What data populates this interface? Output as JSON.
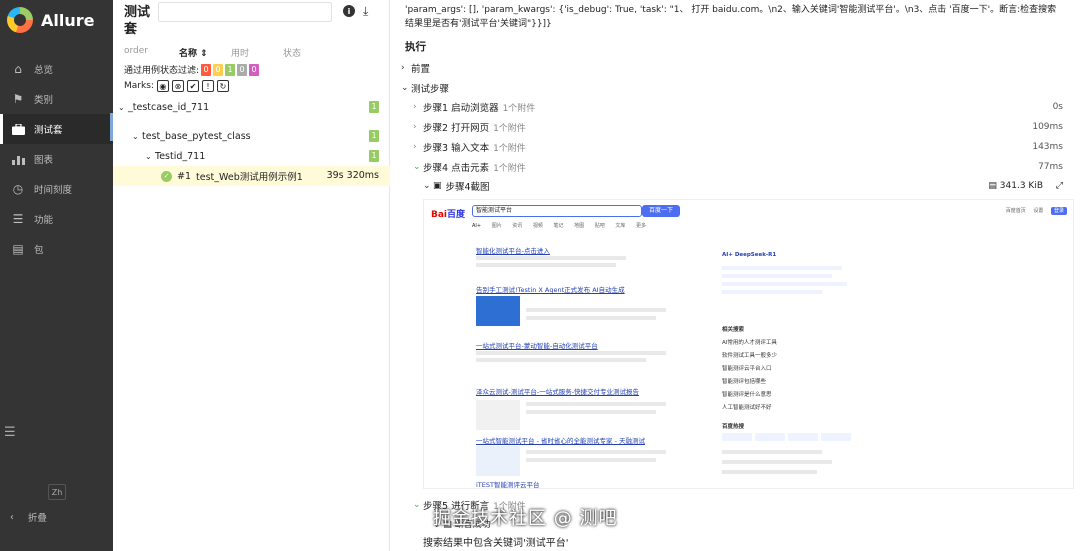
{
  "sidebar": {
    "brand": "Allure",
    "items": [
      {
        "label": "总览",
        "icon": "home-icon"
      },
      {
        "label": "类别",
        "icon": "flag-icon"
      },
      {
        "label": "测试套",
        "icon": "briefcase-icon",
        "active": true
      },
      {
        "label": "图表",
        "icon": "bar-chart-icon"
      },
      {
        "label": "时间刻度",
        "icon": "clock-icon"
      },
      {
        "label": "功能",
        "icon": "list-icon"
      },
      {
        "label": "包",
        "icon": "package-icon"
      }
    ],
    "lang": "Zh",
    "collapse_label": "折叠"
  },
  "suites": {
    "title": "测试套",
    "search_placeholder": "",
    "sort": {
      "order": "order",
      "name": "名称",
      "time": "用时",
      "status": "状态"
    },
    "filter_label": "通过用例状态过滤:",
    "filter_counts": [
      {
        "value": "0",
        "color": "#fd5a3e"
      },
      {
        "value": "0",
        "color": "#ffd050"
      },
      {
        "value": "1",
        "color": "#97cc64"
      },
      {
        "value": "0",
        "color": "#aaaaaa"
      },
      {
        "value": "0",
        "color": "#d35ebe"
      }
    ],
    "marks_label": "Marks:",
    "tree": [
      {
        "label": "_testcase_id_711",
        "count": "1",
        "level": 0
      },
      {
        "label": "test_base_pytest_class",
        "count": "1",
        "level": 1
      },
      {
        "label": "Testid_711",
        "count": "1",
        "level": 2
      }
    ],
    "selected_case": {
      "number": "#1",
      "name": "test_Web测试用例示例1",
      "duration": "39s 320ms"
    }
  },
  "details": {
    "args_text": "'param_args': [], 'param_kwargs': {'is_debug': True, 'task': \"1、 打开 baidu.com。\\n2、输入关键词'智能测试平台'。\\n3、点击 '百度一下'。断言:检查搜索结果里是否有'测试平台'关键词\"}}]}",
    "execution_title": "执行",
    "setup_label": "前置",
    "steps_label": "测试步骤",
    "steps": [
      {
        "label": "步骤1 启动浏览器",
        "attachments": "1个附件",
        "duration": "0s"
      },
      {
        "label": "步骤2 打开网页",
        "attachments": "1个附件",
        "duration": "109ms"
      },
      {
        "label": "步骤3 输入文本",
        "attachments": "1个附件",
        "duration": "143ms"
      },
      {
        "label": "步骤4 点击元素",
        "attachments": "1个附件",
        "duration": "77ms"
      }
    ],
    "attachment": {
      "name": "步骤4截图",
      "size": "341.3 KiB"
    },
    "step5": {
      "label": "步骤5 进行断言",
      "attachments": "1个附件"
    },
    "assert_attachment": "断言成功",
    "assert_text": "搜索结果中包含关键词'测试平台'"
  },
  "screenshot": {
    "logo_a": "Bai",
    "logo_b": "百度",
    "query": "智能测试平台",
    "search_button": "百度一下",
    "top_links": [
      "百度首页",
      "设置"
    ],
    "login": "登录",
    "tabs": [
      "AI+",
      "图片",
      "资讯",
      "视频",
      "笔记",
      "地图",
      "贴吧",
      "文库",
      "更多"
    ],
    "results": [
      "智能化测试平台-点击进入",
      "告别手工测试!Testin X Agent正式发布 AI自动生成",
      "一站式测试平台-蒙动智能-自动化测试平台",
      "泽众云测试-测试平台-一站式服务-快捷交付专业测试报告",
      "一站式智能测试平台 - 省时省心的全能测试专家 - 天融测试",
      "iTEST智能测评云平台"
    ],
    "ai_label": "AI+ DeepSeek-R1",
    "related_title": "相关搜索",
    "related": [
      "AI常用的人才测评工具",
      "软件测试工具一般多少",
      "智能测评云平台入口",
      "智能测评包括哪些",
      "智能测评是什么意思",
      "人工智能测试好不好"
    ],
    "hot_title": "百度热搜"
  },
  "watermark": "掘金技术社区 @ 测吧"
}
